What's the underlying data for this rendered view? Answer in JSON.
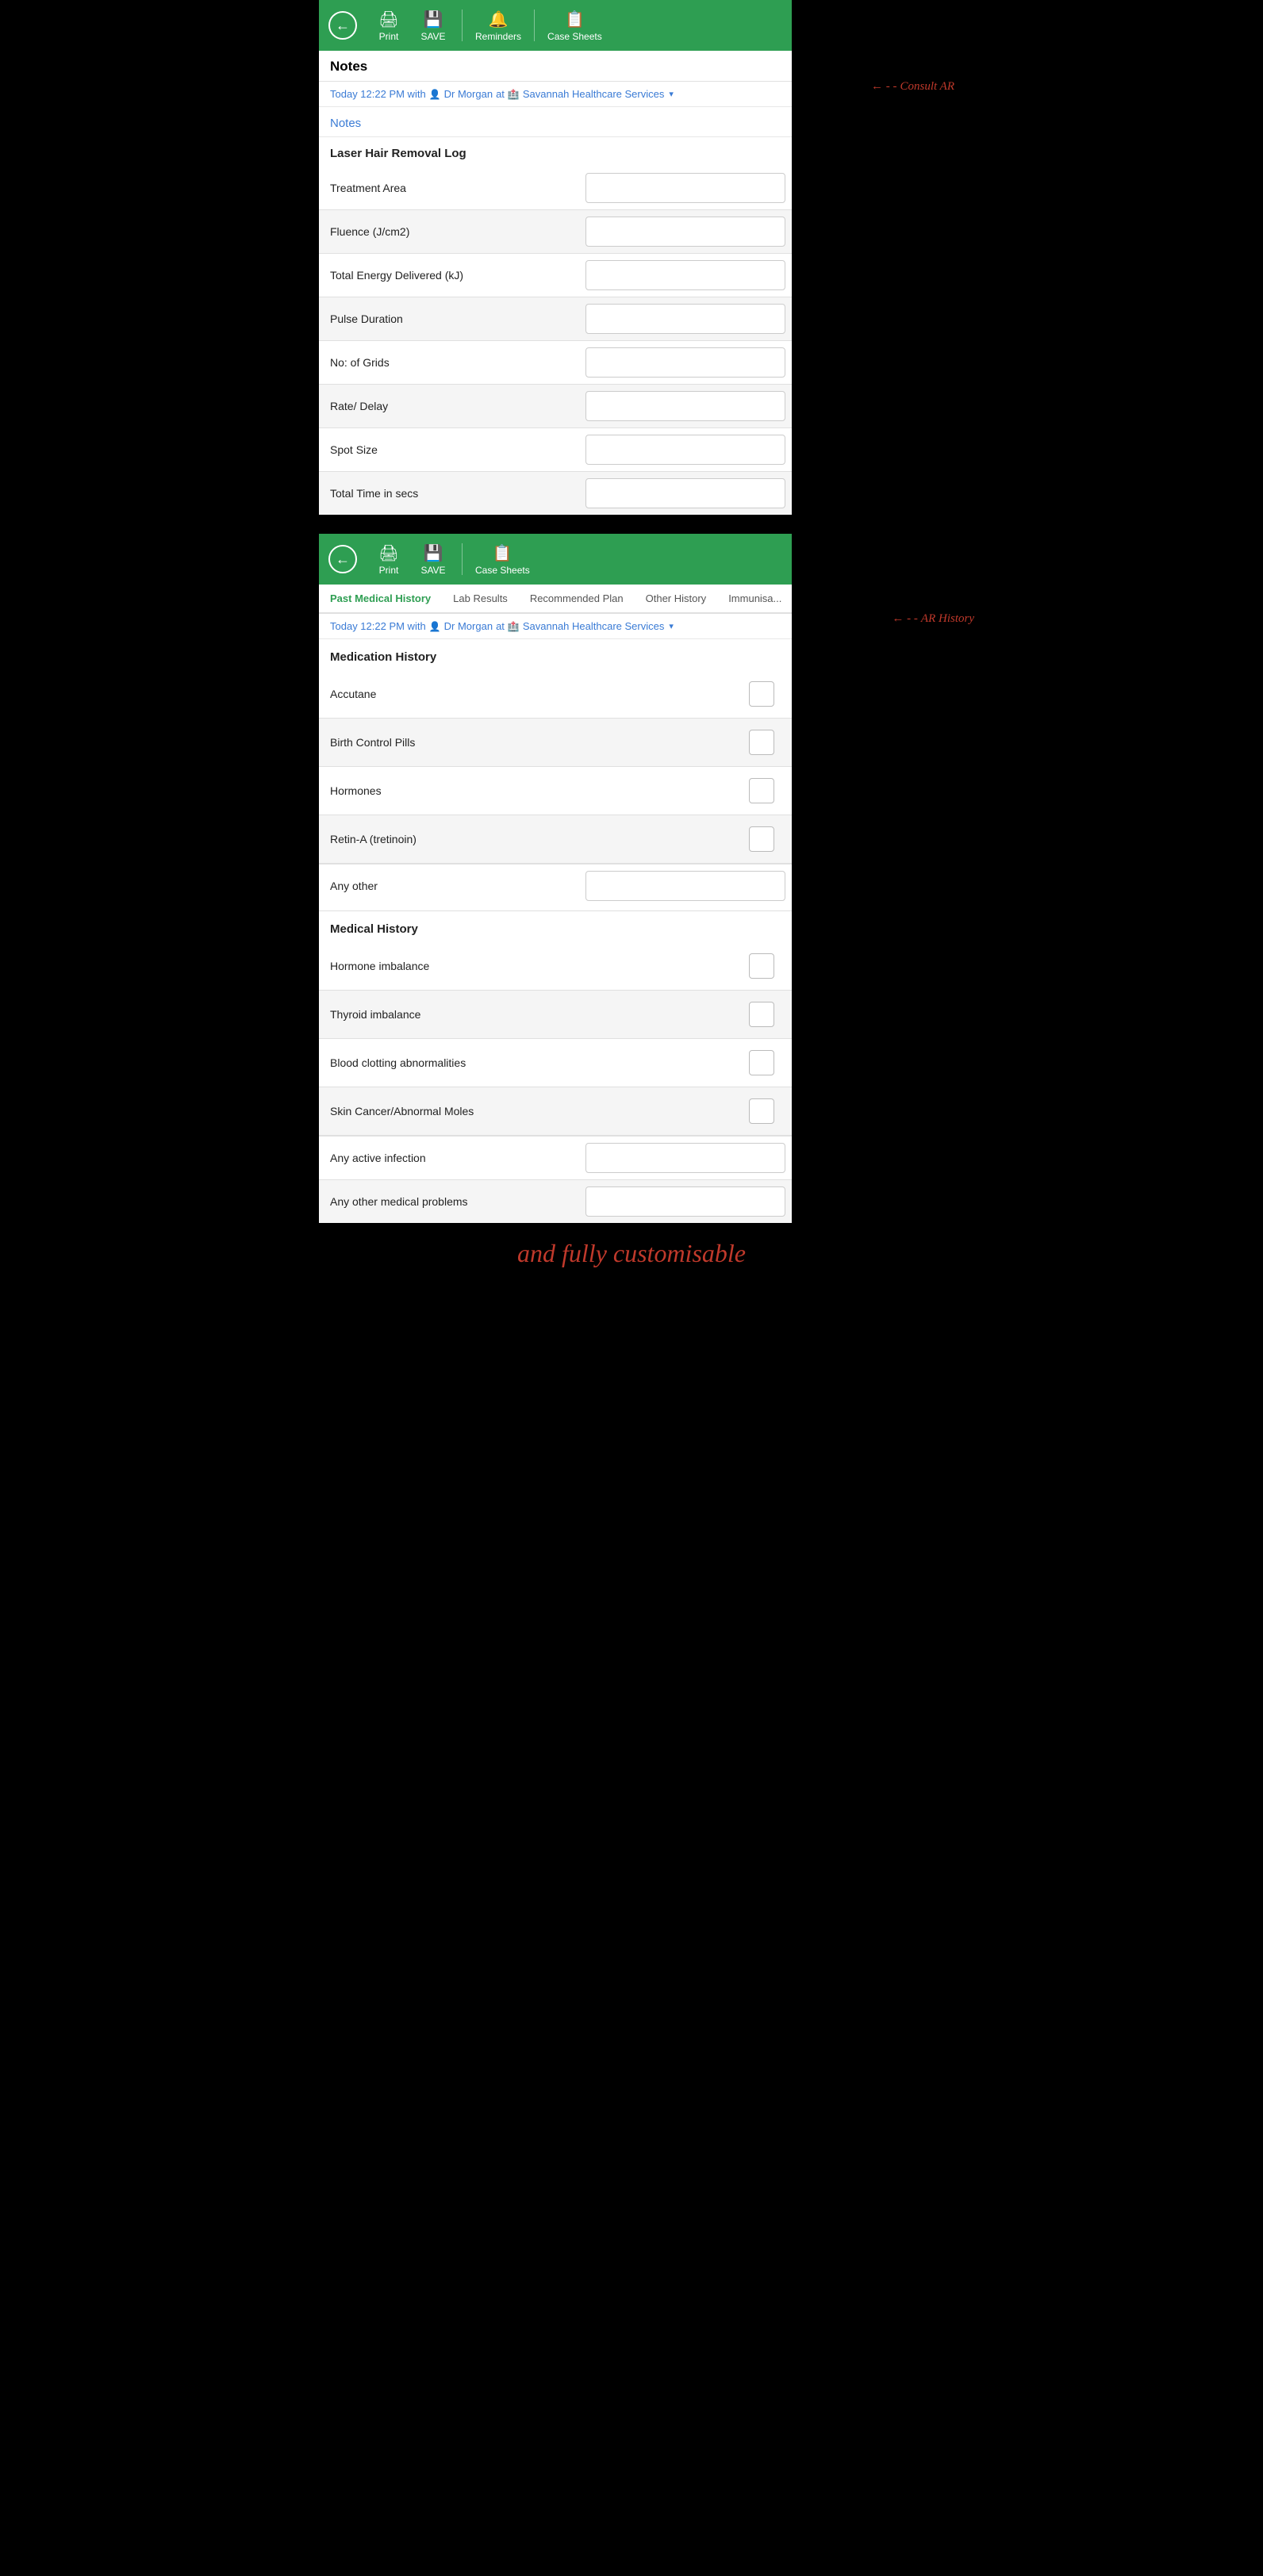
{
  "app": {
    "title": "Notes",
    "toolbar1": {
      "back_label": "←",
      "print_label": "Print",
      "save_label": "SAVE",
      "reminders_label": "Reminders",
      "case_sheets_label": "Case Sheets"
    },
    "toolbar2": {
      "back_label": "←",
      "print_label": "Print",
      "save_label": "SAVE",
      "case_sheets_label": "Case Sheets"
    }
  },
  "panel1": {
    "title": "Notes",
    "date_row": {
      "text": "Today 12:22 PM with",
      "doctor": "Dr Morgan",
      "at": "at",
      "location": "Savannah Healthcare Services"
    },
    "notes_label": "Notes",
    "annotation_top": "Consult AR",
    "form_section": {
      "header": "Laser Hair Removal Log",
      "rows": [
        {
          "label": "Treatment Area",
          "alt": false
        },
        {
          "label": "Fluence (J/cm2)",
          "alt": true
        },
        {
          "label": "Total Energy Delivered (kJ)",
          "alt": false
        },
        {
          "label": "Pulse Duration",
          "alt": true
        },
        {
          "label": "No: of Grids",
          "alt": false
        },
        {
          "label": "Rate/ Delay",
          "alt": true
        },
        {
          "label": "Spot Size",
          "alt": false
        },
        {
          "label": "Total Time in secs",
          "alt": true
        }
      ]
    }
  },
  "panel2": {
    "annotation_top": "AR History",
    "tabs": [
      {
        "label": "Past Medical History",
        "active": true
      },
      {
        "label": "Lab Results",
        "active": false
      },
      {
        "label": "Recommended Plan",
        "active": false
      },
      {
        "label": "Other History",
        "active": false
      },
      {
        "label": "Immunisa...",
        "active": false
      }
    ],
    "date_row": {
      "text": "Today 12:22 PM with",
      "doctor": "Dr Morgan",
      "at": "at",
      "location": "Savannah Healthcare Services"
    },
    "medication_history": {
      "header": "Medication History",
      "items": [
        {
          "label": "Accutane",
          "alt": false,
          "type": "checkbox"
        },
        {
          "label": "Birth Control Pills",
          "alt": true,
          "type": "checkbox"
        },
        {
          "label": "Hormones",
          "alt": false,
          "type": "checkbox"
        },
        {
          "label": "Retin-A (tretinoin)",
          "alt": true,
          "type": "checkbox"
        },
        {
          "label": "Any other",
          "alt": false,
          "type": "text"
        }
      ]
    },
    "medical_history": {
      "header": "Medical History",
      "items": [
        {
          "label": "Hormone imbalance",
          "alt": false,
          "type": "checkbox"
        },
        {
          "label": "Thyroid imbalance",
          "alt": true,
          "type": "checkbox"
        },
        {
          "label": "Blood clotting abnormalities",
          "alt": false,
          "type": "checkbox"
        },
        {
          "label": "Skin Cancer/Abnormal Moles",
          "alt": true,
          "type": "checkbox"
        },
        {
          "label": "Any active infection",
          "alt": false,
          "type": "text"
        },
        {
          "label": "Any other medical problems",
          "alt": true,
          "type": "text"
        }
      ]
    }
  },
  "bottom_annotation": "and fully customisable"
}
